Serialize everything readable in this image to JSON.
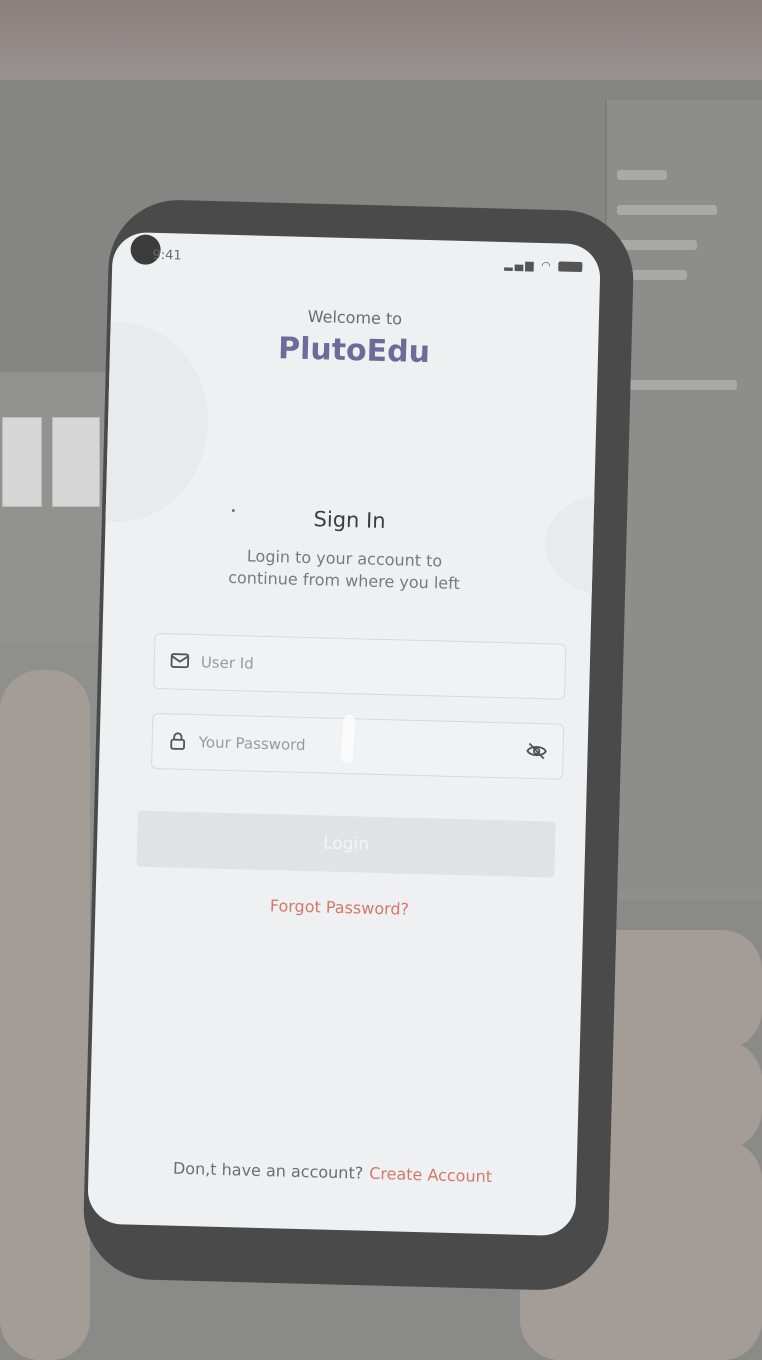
{
  "status_bar": {
    "time": "9:41"
  },
  "welcome": {
    "greeting": "Welcome to",
    "brand": "PlutoEdu"
  },
  "signin": {
    "title": "Sign In",
    "subtitle_line1": "Login to your account to",
    "subtitle_line2": "continue from where you left"
  },
  "form": {
    "user_id_placeholder": "User Id",
    "password_placeholder": "Your Password",
    "login_label": "Login"
  },
  "links": {
    "forgot_password": "Forgot Password?",
    "no_account": "Don,t have an account?",
    "create_account": "Create Account"
  },
  "colors": {
    "brand": "#6f6a99",
    "link": "#d4786a",
    "button_disabled": "#e0e2e5",
    "screen_bg": "#eef0f1"
  },
  "icons": [
    "mail-icon",
    "lock-icon",
    "eye-off-icon",
    "wifi-icon",
    "signal-icon",
    "battery-icon"
  ]
}
